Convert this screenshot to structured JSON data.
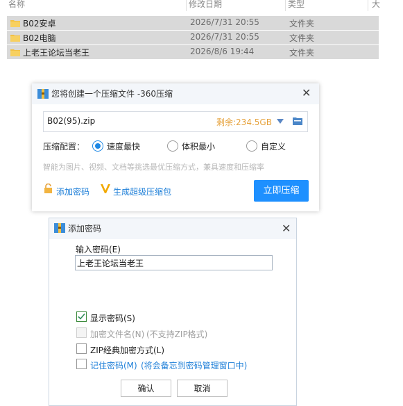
{
  "explorer": {
    "columns": {
      "name": "名称",
      "date": "修改日期",
      "type": "类型",
      "size": "大"
    },
    "rows": [
      {
        "name": "B02安卓",
        "date": "2026/7/31 20:55",
        "type": "文件夹"
      },
      {
        "name": "B02电脑",
        "date": "2026/7/31 20:55",
        "type": "文件夹"
      },
      {
        "name": "上老王论坛当老王",
        "date": "2026/8/6 19:44",
        "type": "文件夹"
      }
    ]
  },
  "compress_dialog": {
    "title": "您将创建一个压缩文件 -360压缩",
    "filename": "B02(95).zip",
    "free_space": "剩余:234.5GB",
    "config_label": "压缩配置：",
    "options": [
      "速度最快",
      "体积最小",
      "自定义"
    ],
    "selected_option": "速度最快",
    "hint": "智能为图片、视频、文档等挑选最优压缩方式，兼具速度和压缩率",
    "add_password": "添加密码",
    "super_package": "生成超级压缩包",
    "compress_now": "立即压缩"
  },
  "password_dialog": {
    "title": "添加密码",
    "input_label": "输入密码(E)",
    "password_value": "上老王论坛当老王",
    "show_password": "显示密码(S)",
    "show_password_checked": true,
    "encrypt_filenames": "加密文件名(N)",
    "encrypt_filenames_note": "(不支持ZIP格式)",
    "zip_classic": "ZIP经典加密方式(L)",
    "remember_password": "记住密码(M)",
    "remember_note": "(将会备忘到密码管理窗口中)",
    "ok": "确认",
    "cancel": "取消"
  },
  "colors": {
    "accent": "#1e90ff",
    "warning": "#e6a23c",
    "selected_row": "#d9d9d9"
  }
}
